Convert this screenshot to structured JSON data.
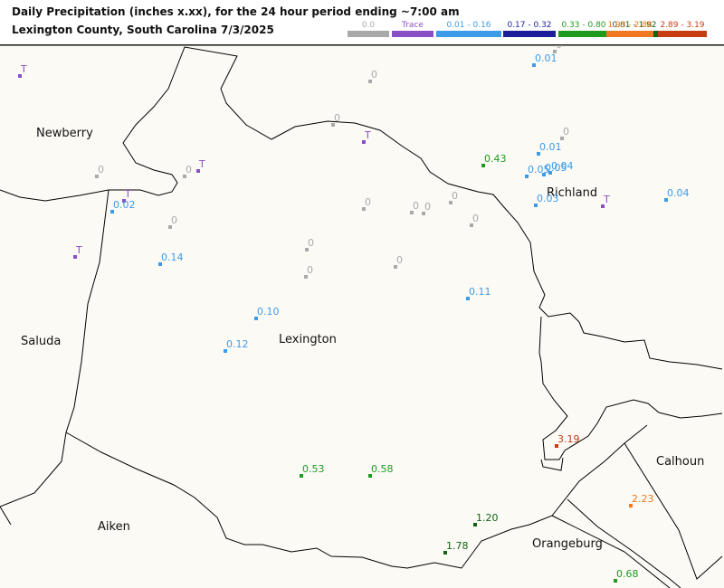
{
  "title_line1": "Daily Precipitation (inches  x.xx),  for the 24 hour period ending ~7:00 am",
  "title_line2": "Lexington County, South Carolina  7/3/2025",
  "legend": [
    {
      "label": "0.0",
      "color": "#a9a9a9"
    },
    {
      "label": "Trace",
      "color": "#8a4fc7"
    },
    {
      "label": "0.01 - 0.16",
      "color": "#3d9be9"
    },
    {
      "label": "0.17 - 0.32",
      "color": "#1e1e9a"
    },
    {
      "label": "0.33 - 0.80",
      "color": "#1f9a1f"
    },
    {
      "label": "0.81 - 1.92",
      "color": "#146214"
    },
    {
      "label": "1.93 - 2.88",
      "color": "#f07820"
    },
    {
      "label": "2.89 - 3.19",
      "color": "#c83c14"
    }
  ],
  "places": [
    "Newberry",
    "Richland",
    "Saluda",
    "Lexington",
    "Calhoun",
    "Aiken",
    "Orangeburg"
  ],
  "observations": [
    {
      "label": "T",
      "cat": 1
    },
    {
      "label": "0",
      "cat": 0
    },
    {
      "label": "0.01",
      "cat": 2
    },
    {
      "label": "0",
      "cat": 0
    },
    {
      "label": "0",
      "cat": 0
    },
    {
      "label": "T",
      "cat": 1
    },
    {
      "label": "0",
      "cat": 0
    },
    {
      "label": "0.01",
      "cat": 2
    },
    {
      "label": "0.43",
      "cat": 4
    },
    {
      "label": "0.05",
      "cat": 2
    },
    {
      "label": "0.04",
      "cat": 2
    },
    {
      "label": "0.05",
      "cat": 2
    },
    {
      "label": "0",
      "cat": 0
    },
    {
      "label": "0",
      "cat": 0
    },
    {
      "label": "T",
      "cat": 1
    },
    {
      "label": "T",
      "cat": 1
    },
    {
      "label": "0.02",
      "cat": 2
    },
    {
      "label": "0",
      "cat": 0
    },
    {
      "label": "0",
      "cat": 0
    },
    {
      "label": "0",
      "cat": 0
    },
    {
      "label": "0",
      "cat": 0
    },
    {
      "label": "0.03",
      "cat": 2
    },
    {
      "label": "T",
      "cat": 1
    },
    {
      "label": "0.04",
      "cat": 2
    },
    {
      "label": "0",
      "cat": 0
    },
    {
      "label": "0",
      "cat": 0
    },
    {
      "label": "0",
      "cat": 0
    },
    {
      "label": "T",
      "cat": 1
    },
    {
      "label": "0.14",
      "cat": 2
    },
    {
      "label": "0",
      "cat": 0
    },
    {
      "label": "0",
      "cat": 0
    },
    {
      "label": "0.11",
      "cat": 2
    },
    {
      "label": "0.10",
      "cat": 2
    },
    {
      "label": "0.12",
      "cat": 2
    },
    {
      "label": "3.19",
      "cat": 7
    },
    {
      "label": "0.53",
      "cat": 4
    },
    {
      "label": "0.58",
      "cat": 4
    },
    {
      "label": "2.23",
      "cat": 6
    },
    {
      "label": "1.20",
      "cat": 5
    },
    {
      "label": "1.78",
      "cat": 5
    },
    {
      "label": "0.68",
      "cat": 4
    }
  ]
}
